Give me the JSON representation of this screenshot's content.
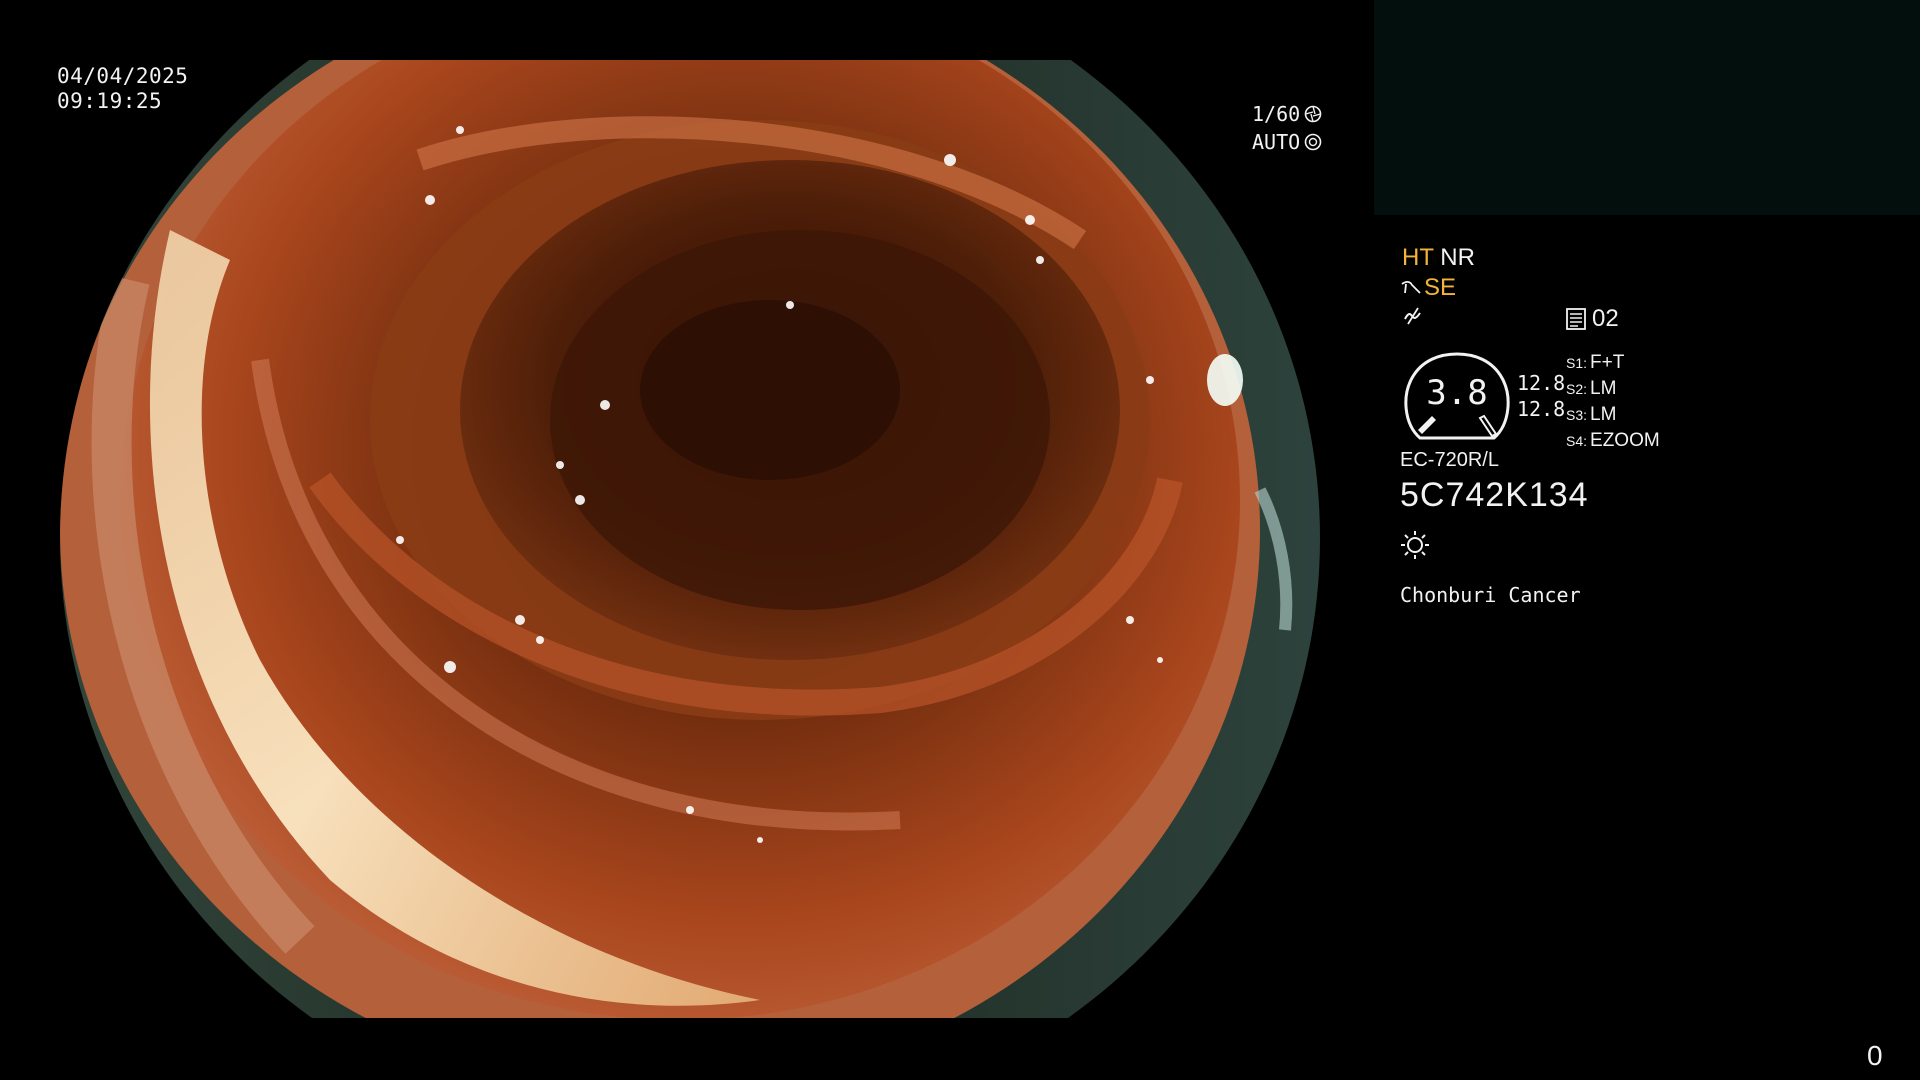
{
  "overlay": {
    "date": "04/04/2025",
    "time": "09:19:25",
    "shutter_speed": "1/60",
    "iris_mode": "AUTO"
  },
  "enhancement": {
    "ht_label": "HT",
    "nr_label": "NR",
    "se_label": "SE",
    "memory_label": "02"
  },
  "zoom": {
    "value": "3.8",
    "upper": "12.8",
    "lower": "12.8"
  },
  "switches": [
    {
      "key": "S1:",
      "value": "F+T"
    },
    {
      "key": "S2:",
      "value": "LM"
    },
    {
      "key": "S3:",
      "value": "LM"
    },
    {
      "key": "S4:",
      "value": "EZOOM"
    }
  ],
  "scope": {
    "model": "EC-720R/L",
    "serial": "5C742K134"
  },
  "hospital": "Chonburi Cancer",
  "frame_counter": "0",
  "colors": {
    "accent_yellow": "#f2b43a",
    "text": "#f2f2f2",
    "thumb_panel": "#030f0c"
  },
  "icons": {
    "shutter": "shutter-icon",
    "iris": "iris-icon",
    "scissor_se": "se-mode-icon",
    "noise": "noise-reduction-icon",
    "memory": "memory-icon",
    "light": "light-source-icon"
  }
}
